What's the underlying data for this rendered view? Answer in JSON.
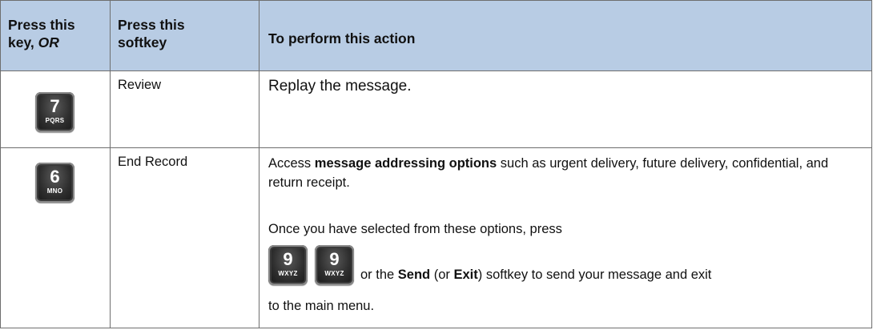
{
  "header": {
    "col1_line1": "Press this",
    "col1_line2_a": "key, ",
    "col1_line2_b": "OR",
    "col2_line1": "Press this",
    "col2_line2": "softkey",
    "col3": "To perform this action"
  },
  "rows": [
    {
      "key": {
        "number": "7",
        "letters": "PQRS"
      },
      "softkey": "Review",
      "action": "Replay the message."
    },
    {
      "key": {
        "number": "6",
        "letters": "MNO"
      },
      "softkey": "End Record",
      "action_p1_a": "Access ",
      "action_p1_bold": "message addressing options",
      "action_p1_b": " such as urgent delivery, future delivery, confidential, and return receipt.",
      "action_p2": "Once you have selected from these options, press",
      "inline_keys": [
        {
          "number": "9",
          "letters": "WXYZ"
        },
        {
          "number": "9",
          "letters": "WXYZ"
        }
      ],
      "action_p3_a": " or the ",
      "action_p3_send": "Send",
      "action_p3_b": " (or ",
      "action_p3_exit": "Exit",
      "action_p3_c": ") softkey to send your message and exit",
      "action_p4": "to the main menu."
    }
  ],
  "colors": {
    "header_bg": "#b8cce4",
    "border": "#6e6e6e",
    "key_bg": "#2e2e2e"
  }
}
